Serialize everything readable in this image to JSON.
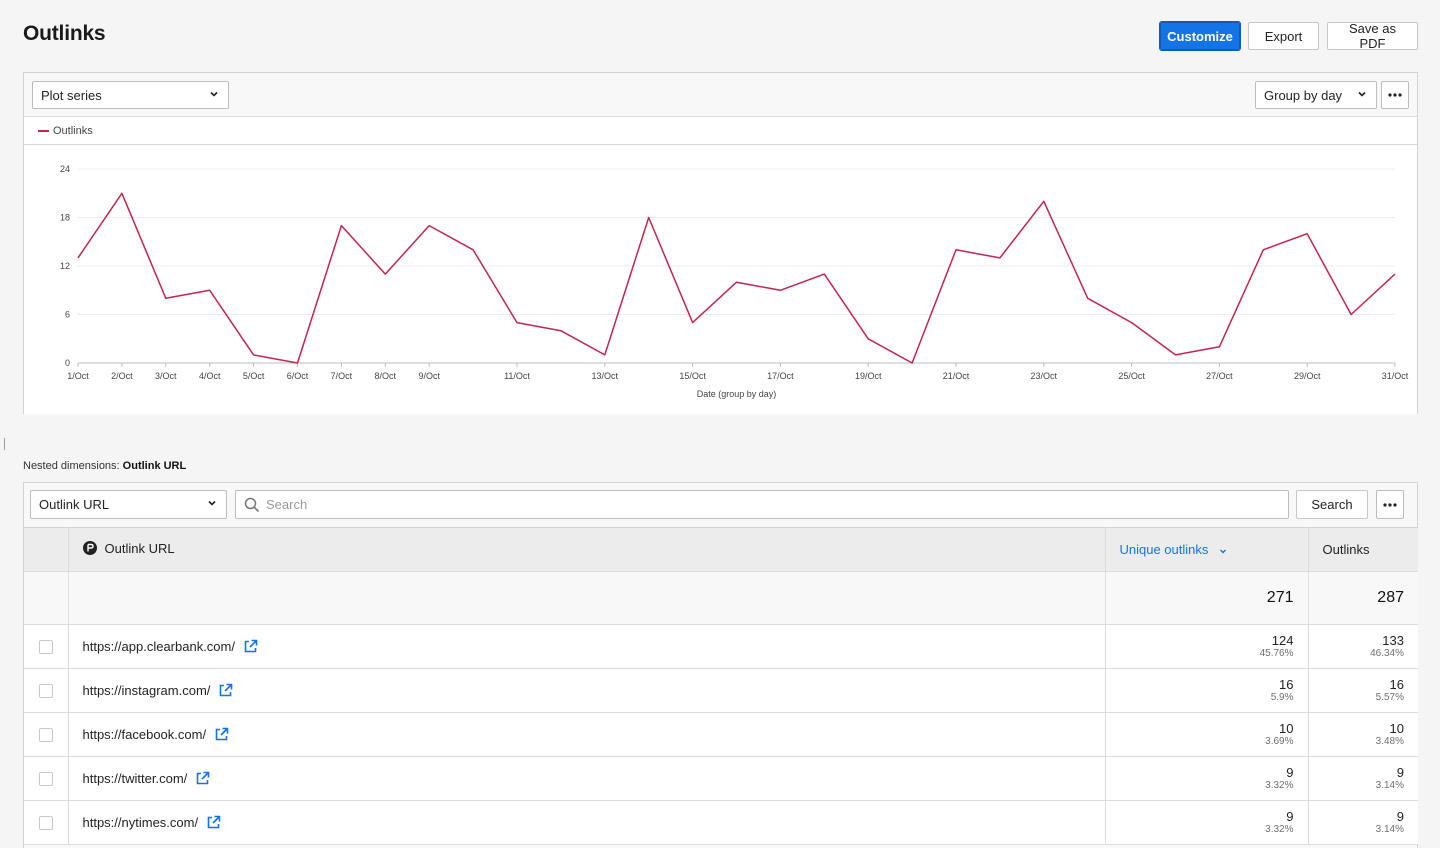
{
  "page": {
    "title": "Outlinks"
  },
  "actions": {
    "customize": "Customize",
    "export": "Export",
    "save_pdf": "Save as PDF"
  },
  "chart_toolbar": {
    "plot_series": "Plot series",
    "group_by": "Group by day"
  },
  "colors": {
    "series": "#c3254c",
    "accent": "#1473e6"
  },
  "chart_data": {
    "type": "line",
    "x": [
      "1/Oct",
      "2/Oct",
      "3/Oct",
      "4/Oct",
      "5/Oct",
      "6/Oct",
      "7/Oct",
      "8/Oct",
      "9/Oct",
      "10/Oct",
      "11/Oct",
      "12/Oct",
      "13/Oct",
      "14/Oct",
      "15/Oct",
      "16/Oct",
      "17/Oct",
      "18/Oct",
      "19/Oct",
      "20/Oct",
      "21/Oct",
      "22/Oct",
      "23/Oct",
      "24/Oct",
      "25/Oct",
      "26/Oct",
      "27/Oct",
      "28/Oct",
      "29/Oct",
      "30/Oct",
      "31/Oct"
    ],
    "x_tick_labels": [
      "1/Oct",
      "2/Oct",
      "3/Oct",
      "4/Oct",
      "5/Oct",
      "6/Oct",
      "7/Oct",
      "8/Oct",
      "9/Oct",
      "11/Oct",
      "13/Oct",
      "15/Oct",
      "17/Oct",
      "19/Oct",
      "21/Oct",
      "23/Oct",
      "25/Oct",
      "27/Oct",
      "29/Oct",
      "31/Oct"
    ],
    "series": [
      {
        "name": "Outlinks",
        "values": [
          13,
          21,
          8,
          9,
          1,
          0,
          17,
          11,
          17,
          14,
          5,
          4,
          1,
          18,
          5,
          10,
          9,
          11,
          3,
          0,
          14,
          13,
          20,
          8,
          5,
          1,
          2,
          14,
          16,
          6,
          11
        ]
      }
    ],
    "yticks": [
      0,
      6,
      12,
      18,
      24
    ],
    "ylim": [
      0,
      24
    ],
    "xlabel": "Date (group by day)",
    "ylabel": "",
    "grid": true,
    "legend": "top-left"
  },
  "nested": {
    "prefix": "Nested dimensions:",
    "dimension": "Outlink URL"
  },
  "table_toolbar": {
    "dimension_select": "Outlink URL",
    "search_placeholder": "Search",
    "search_button": "Search"
  },
  "table": {
    "headers": {
      "url": "Outlink URL",
      "unique": "Unique outlinks",
      "outlinks": "Outlinks"
    },
    "totals": {
      "unique": "271",
      "outlinks": "287"
    },
    "rows": [
      {
        "url": "https://app.clearbank.com/",
        "unique": "124",
        "unique_pct": "45.76%",
        "outlinks": "133",
        "outlinks_pct": "46.34%"
      },
      {
        "url": "https://instagram.com/",
        "unique": "16",
        "unique_pct": "5.9%",
        "outlinks": "16",
        "outlinks_pct": "5.57%"
      },
      {
        "url": "https://facebook.com/",
        "unique": "10",
        "unique_pct": "3.69%",
        "outlinks": "10",
        "outlinks_pct": "3.48%"
      },
      {
        "url": "https://twitter.com/",
        "unique": "9",
        "unique_pct": "3.32%",
        "outlinks": "9",
        "outlinks_pct": "3.14%"
      },
      {
        "url": "https://nytimes.com/",
        "unique": "9",
        "unique_pct": "3.32%",
        "outlinks": "9",
        "outlinks_pct": "3.14%"
      }
    ]
  }
}
